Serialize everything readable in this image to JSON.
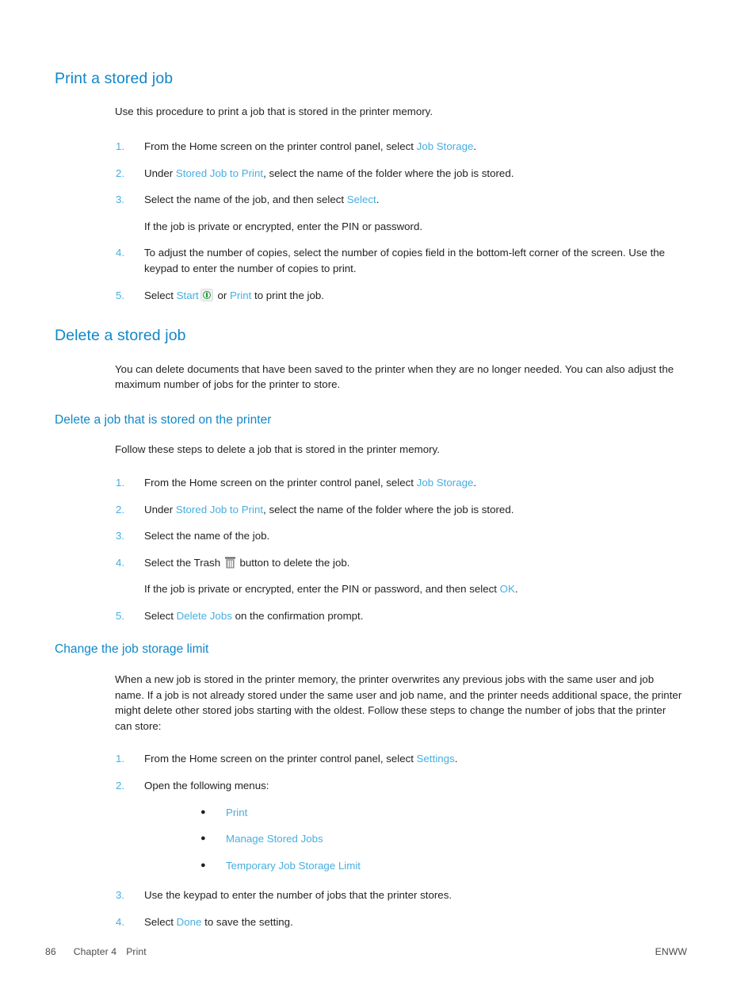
{
  "colors": {
    "heading_blue": "#1187c9",
    "ui_term_blue": "#47aee0",
    "body_text": "#231f20",
    "start_icon_green": "#1d9d3e"
  },
  "sections": [
    {
      "id": "print-a-stored-job",
      "heading": "Print a stored job",
      "intro": "Use this procedure to print a job that is stored in the printer memory.",
      "steps": [
        {
          "num": "1.",
          "parts": [
            {
              "t": "From the Home screen on the printer control panel, select ",
              "ui": false
            },
            {
              "t": "Job Storage",
              "ui": true
            },
            {
              "t": ".",
              "ui": false
            }
          ]
        },
        {
          "num": "2.",
          "parts": [
            {
              "t": "Under ",
              "ui": false
            },
            {
              "t": "Stored Job to Print",
              "ui": true
            },
            {
              "t": ", select the name of the folder where the job is stored.",
              "ui": false
            }
          ]
        },
        {
          "num": "3.",
          "parts": [
            {
              "t": "Select the name of the job, and then select ",
              "ui": false
            },
            {
              "t": "Select",
              "ui": true
            },
            {
              "t": ".",
              "ui": false
            }
          ],
          "sub": "If the job is private or encrypted, enter the PIN or password."
        },
        {
          "num": "4.",
          "parts": [
            {
              "t": "To adjust the number of copies, select the number of copies field in the bottom-left corner of the screen. Use the keypad to enter the number of copies to print.",
              "ui": false
            }
          ]
        },
        {
          "num": "5.",
          "parts": [
            {
              "t": "Select ",
              "ui": false
            },
            {
              "t": "Start",
              "ui": true
            },
            {
              "t": "ICON:start-icon",
              "ui": false
            },
            {
              "t": " or ",
              "ui": false
            },
            {
              "t": "Print",
              "ui": true
            },
            {
              "t": " to print the job.",
              "ui": false
            }
          ]
        }
      ]
    },
    {
      "id": "delete-a-stored-job",
      "heading": "Delete a stored job",
      "intro": "You can delete documents that have been saved to the printer when they are no longer needed. You can also adjust the maximum number of jobs for the printer to store.",
      "subsections": [
        {
          "id": "delete-a-job-that-is-stored-on-the-printer",
          "heading": "Delete a job that is stored on the printer",
          "intro": "Follow these steps to delete a job that is stored in the printer memory.",
          "steps": [
            {
              "num": "1.",
              "parts": [
                {
                  "t": "From the Home screen on the printer control panel, select ",
                  "ui": false
                },
                {
                  "t": "Job Storage",
                  "ui": true
                },
                {
                  "t": ".",
                  "ui": false
                }
              ]
            },
            {
              "num": "2.",
              "parts": [
                {
                  "t": "Under ",
                  "ui": false
                },
                {
                  "t": "Stored Job to Print",
                  "ui": true
                },
                {
                  "t": ", select the name of the folder where the job is stored.",
                  "ui": false
                }
              ]
            },
            {
              "num": "3.",
              "parts": [
                {
                  "t": "Select the name of the job.",
                  "ui": false
                }
              ]
            },
            {
              "num": "4.",
              "parts": [
                {
                  "t": "Select the Trash ",
                  "ui": false
                },
                {
                  "t": "ICON:trash-icon",
                  "ui": false
                },
                {
                  "t": " button to delete the job.",
                  "ui": false
                }
              ],
              "sub_parts": [
                {
                  "t": "If the job is private or encrypted, enter the PIN or password, and then select ",
                  "ui": false
                },
                {
                  "t": "OK",
                  "ui": true
                },
                {
                  "t": ".",
                  "ui": false
                }
              ]
            },
            {
              "num": "5.",
              "parts": [
                {
                  "t": "Select ",
                  "ui": false
                },
                {
                  "t": "Delete Jobs",
                  "ui": true
                },
                {
                  "t": " on the confirmation prompt.",
                  "ui": false
                }
              ]
            }
          ]
        },
        {
          "id": "change-the-job-storage-limit",
          "heading": "Change the job storage limit",
          "intro": "When a new job is stored in the printer memory, the printer overwrites any previous jobs with the same user and job name. If a job is not already stored under the same user and job name, and the printer needs additional space, the printer might delete other stored jobs starting with the oldest. Follow these steps to change the number of jobs that the printer can store:",
          "steps": [
            {
              "num": "1.",
              "parts": [
                {
                  "t": "From the Home screen on the printer control panel, select ",
                  "ui": false
                },
                {
                  "t": "Settings",
                  "ui": true
                },
                {
                  "t": ".",
                  "ui": false
                }
              ]
            },
            {
              "num": "2.",
              "parts": [
                {
                  "t": "Open the following menus:",
                  "ui": false
                }
              ],
              "bullets": [
                "Print",
                "Manage Stored Jobs",
                "Temporary Job Storage Limit"
              ]
            },
            {
              "num": "3.",
              "parts": [
                {
                  "t": "Use the keypad to enter the number of jobs that the printer stores.",
                  "ui": false
                }
              ]
            },
            {
              "num": "4.",
              "parts": [
                {
                  "t": "Select ",
                  "ui": false
                },
                {
                  "t": "Done",
                  "ui": true
                },
                {
                  "t": " to save the setting.",
                  "ui": false
                }
              ]
            }
          ]
        }
      ]
    }
  ],
  "footer": {
    "page_number": "86",
    "chapter": "Chapter 4",
    "chapter_title": "Print",
    "locale": "ENWW"
  }
}
